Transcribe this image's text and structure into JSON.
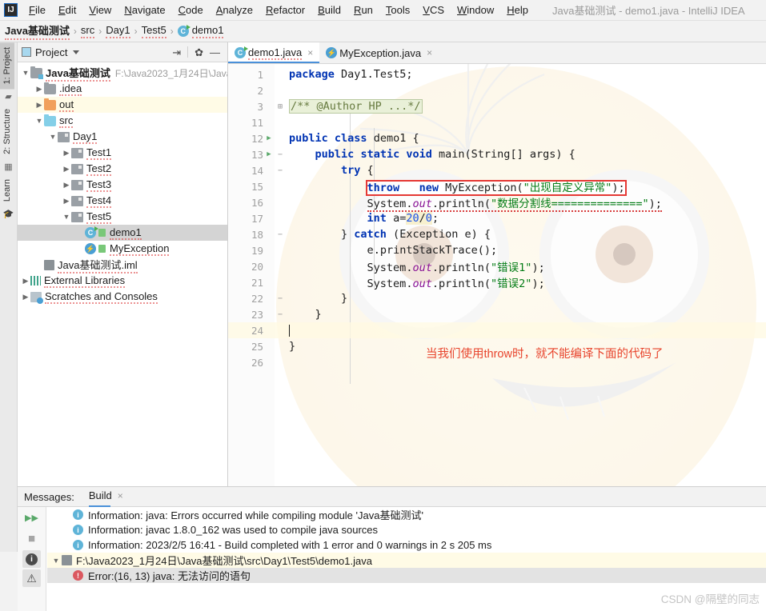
{
  "window": {
    "title": "Java基础测试 - demo1.java - IntelliJ IDEA",
    "logo": "IJ"
  },
  "menubar": {
    "items": [
      {
        "label": "File"
      },
      {
        "label": "Edit"
      },
      {
        "label": "View"
      },
      {
        "label": "Navigate"
      },
      {
        "label": "Code"
      },
      {
        "label": "Analyze"
      },
      {
        "label": "Refactor"
      },
      {
        "label": "Build"
      },
      {
        "label": "Run"
      },
      {
        "label": "Tools"
      },
      {
        "label": "VCS"
      },
      {
        "label": "Window"
      },
      {
        "label": "Help"
      }
    ]
  },
  "breadcrumb": {
    "separator": "›",
    "items": [
      {
        "label": "Java基础测试"
      },
      {
        "label": "src"
      },
      {
        "label": "Day1"
      },
      {
        "label": "Test5"
      },
      {
        "label": "demo1"
      }
    ]
  },
  "toolwindow_strip": {
    "left": [
      {
        "label": "1: Project",
        "icon": "project-icon"
      },
      {
        "label": "2: Structure",
        "icon": "structure-icon"
      },
      {
        "label": "Learn",
        "icon": "graduation-cap-icon"
      }
    ]
  },
  "project_panel": {
    "title": "Project",
    "tools": [
      {
        "name": "collapse-all-icon",
        "glyph": "⇥"
      },
      {
        "name": "settings-gear-icon",
        "glyph": "✿"
      },
      {
        "name": "hide-panel-icon",
        "glyph": "—"
      }
    ],
    "tree": [
      {
        "label": "Java基础测试",
        "path": "F:\\Java2023_1月24日\\Java",
        "indent": 0,
        "arrow": "▼",
        "icon": "module-icon",
        "bold": true
      },
      {
        "label": ".idea",
        "indent": 1,
        "arrow": "▶",
        "icon": "folder-grey-icon"
      },
      {
        "label": "out",
        "indent": 1,
        "arrow": "▶",
        "icon": "folder-orange-icon",
        "highlight": true
      },
      {
        "label": "src",
        "indent": 1,
        "arrow": "▼",
        "icon": "folder-blue-icon"
      },
      {
        "label": "Day1",
        "indent": 2,
        "arrow": "▼",
        "icon": "package-icon"
      },
      {
        "label": "Test1",
        "indent": 3,
        "arrow": "▶",
        "icon": "package-icon"
      },
      {
        "label": "Test2",
        "indent": 3,
        "arrow": "▶",
        "icon": "package-icon"
      },
      {
        "label": "Test3",
        "indent": 3,
        "arrow": "▶",
        "icon": "package-icon"
      },
      {
        "label": "Test4",
        "indent": 3,
        "arrow": "▶",
        "icon": "package-icon"
      },
      {
        "label": "Test5",
        "indent": 3,
        "arrow": "▼",
        "icon": "package-icon"
      },
      {
        "label": "demo1",
        "indent": 4,
        "arrow": "",
        "icon": "java-class-icon",
        "selected": true
      },
      {
        "label": "MyException",
        "indent": 4,
        "arrow": "",
        "icon": "java-exception-icon"
      },
      {
        "label": "Java基础测试.iml",
        "indent": 1,
        "arrow": "",
        "icon": "iml-file-icon"
      },
      {
        "label": "External Libraries",
        "indent": 0,
        "arrow": "▶",
        "icon": "libraries-icon"
      },
      {
        "label": "Scratches and Consoles",
        "indent": 0,
        "arrow": "▶",
        "icon": "scratches-icon"
      }
    ]
  },
  "editor": {
    "tabs": [
      {
        "label": "demo1.java",
        "icon": "java-class-icon",
        "active": true,
        "close": "×"
      },
      {
        "label": "MyException.java",
        "icon": "java-exception-icon",
        "active": false,
        "close": "×"
      }
    ],
    "annotation": "当我们使用throw时，就不能编译下面的代码了",
    "lines": [
      {
        "num": "1",
        "indent": 0,
        "text": "package Day1.Test5;"
      },
      {
        "num": "2",
        "indent": 0,
        "text": ""
      },
      {
        "num": "3",
        "indent": 0,
        "text": "/** @Author HP ...*/",
        "folded": true
      },
      {
        "num": "11",
        "indent": 0,
        "text": ""
      },
      {
        "num": "12",
        "indent": 0,
        "text": "public class demo1 {",
        "runmark": true
      },
      {
        "num": "13",
        "indent": 1,
        "text": "public static void main(String[] args) {",
        "runmark": true,
        "fold": "−"
      },
      {
        "num": "14",
        "indent": 2,
        "text": "try {",
        "fold": "−"
      },
      {
        "num": "15",
        "indent": 3,
        "text": "throw   new MyException(\"出现自定义异常\");",
        "boxed": true
      },
      {
        "num": "16",
        "indent": 3,
        "text": "System.out.println(\"数据分割线==============\");",
        "error": true
      },
      {
        "num": "17",
        "indent": 3,
        "text": "int a=20/0;"
      },
      {
        "num": "18",
        "indent": 2,
        "text": "} catch (Exception e) {",
        "fold": "−"
      },
      {
        "num": "19",
        "indent": 3,
        "text": "e.printStackTrace();"
      },
      {
        "num": "20",
        "indent": 3,
        "text": "System.out.println(\"错误1\");"
      },
      {
        "num": "21",
        "indent": 3,
        "text": "System.out.println(\"错误2\");"
      },
      {
        "num": "22",
        "indent": 2,
        "text": "}",
        "fold": "−"
      },
      {
        "num": "23",
        "indent": 1,
        "text": "}",
        "fold": "−"
      },
      {
        "num": "24",
        "indent": 0,
        "text": "",
        "current": true
      },
      {
        "num": "25",
        "indent": 0,
        "text": "}"
      },
      {
        "num": "26",
        "indent": 0,
        "text": ""
      }
    ]
  },
  "messages": {
    "label": "Messages:",
    "tab": "Build",
    "tab_close": "×",
    "rail": [
      {
        "name": "rerun-icon",
        "glyph": "▶▶"
      },
      {
        "name": "stop-icon",
        "glyph": "■"
      },
      {
        "name": "info-filter-icon",
        "glyph": "i"
      },
      {
        "name": "warning-filter-icon",
        "glyph": "!"
      }
    ],
    "rows": [
      {
        "icon": "info-icon",
        "text": "Information: java: Errors occurred while compiling module 'Java基础测试'",
        "indent": 1
      },
      {
        "icon": "info-icon",
        "text": "Information: javac 1.8.0_162 was used to compile java sources",
        "indent": 1
      },
      {
        "icon": "info-icon",
        "text": "Information: 2023/2/5 16:41 - Build completed with 1 error and 0 warnings in 2 s 205 ms",
        "indent": 1
      },
      {
        "icon": "file-icon",
        "text": "F:\\Java2023_1月24日\\Java基础测试\\src\\Day1\\Test5\\demo1.java",
        "indent": 0,
        "arrow": "▼",
        "highlight": true
      },
      {
        "icon": "error-icon",
        "text": "Error:(16, 13)  java: 无法访问的语句",
        "indent": 1,
        "selected": true
      }
    ]
  },
  "watermark": "CSDN @隔壁的同志"
}
